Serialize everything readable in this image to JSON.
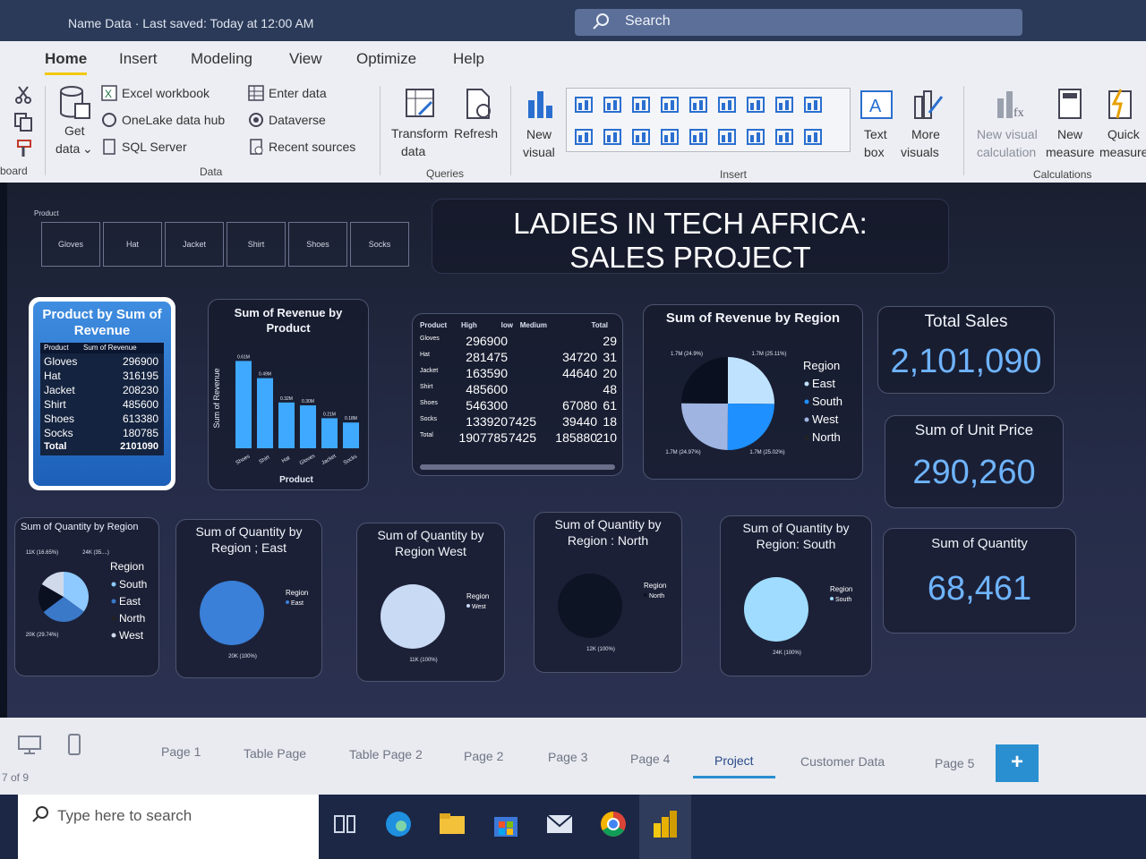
{
  "titlebar": {
    "title": "Name Data · Last saved: Today at 12:00 AM",
    "search": "Search"
  },
  "ribbon": {
    "tabs": [
      "Home",
      "Insert",
      "Modeling",
      "View",
      "Optimize",
      "Help"
    ],
    "clipboard_group": "board",
    "get_data": [
      "Get",
      "data"
    ],
    "data_items": [
      "Excel workbook",
      "OneLake data hub",
      "SQL Server",
      "Enter data",
      "Dataverse",
      "Recent sources"
    ],
    "data_group": "Data",
    "transform": [
      "Transform",
      "data"
    ],
    "refresh": "Refresh",
    "queries_group": "Queries",
    "new_visual": [
      "New",
      "visual"
    ],
    "insert_group": "Insert",
    "text_box": [
      "Text",
      "box"
    ],
    "more_visuals": [
      "More",
      "visuals"
    ],
    "new_visual_calc": [
      "New visual",
      "calculation"
    ],
    "new_measure": [
      "New",
      "measure"
    ],
    "quick_measure": [
      "Quick",
      "measure"
    ],
    "calculations_group": "Calculations"
  },
  "report": {
    "title_line1": "LADIES IN TECH AFRICA:",
    "title_line2": "SALES PROJECT",
    "slicer": {
      "label": "Product",
      "items": [
        "Gloves",
        "Hat",
        "Jacket",
        "Shirt",
        "Shoes",
        "Socks"
      ]
    },
    "product_table": {
      "title": "Product by Sum of Revenue",
      "headers": [
        "Product",
        "Sum of Revenue"
      ],
      "rows": [
        [
          "Gloves",
          "296900"
        ],
        [
          "Hat",
          "316195"
        ],
        [
          "Jacket",
          "208230"
        ],
        [
          "Shirt",
          "485600"
        ],
        [
          "Shoes",
          "613380"
        ],
        [
          "Socks",
          "180785"
        ]
      ],
      "total": [
        "Total",
        "2101090"
      ]
    },
    "matrix": {
      "headers": [
        "Product",
        "High",
        "low",
        "Medium",
        "Total"
      ],
      "rows": [
        [
          "Gloves",
          "296900",
          "",
          "",
          "29"
        ],
        [
          "Hat",
          "281475",
          "",
          "34720",
          "31"
        ],
        [
          "Jacket",
          "163590",
          "",
          "44640",
          "20"
        ],
        [
          "Shirt",
          "485600",
          "",
          "",
          "48"
        ],
        [
          "Shoes",
          "546300",
          "",
          "67080",
          "61"
        ],
        [
          "Socks",
          "133920",
          "7425",
          "39440",
          "18"
        ],
        [
          "Total",
          "1907785",
          "7425",
          "185880",
          "210"
        ]
      ]
    },
    "kpis": {
      "total_sales_label": "Total Sales",
      "total_sales_value": "2,101,090",
      "unit_price_label": "Sum of Unit Price",
      "unit_price_value": "290,260",
      "quantity_label": "Sum of Quantity",
      "quantity_value": "68,461"
    },
    "region_legend": {
      "title": "Region",
      "items": [
        "East",
        "South",
        "West",
        "North"
      ]
    },
    "region_pie_labels": [
      "1.7M (24.9%)",
      "1.7M (25.11%)",
      "1.7M (24.97%)",
      "1.7M (25.02%)"
    ],
    "qty_region_legend": [
      "South",
      "East",
      "North",
      "West"
    ],
    "qty_region_labels": [
      "11K (16.65%)",
      "24K (35....)",
      "20K (29.74%)"
    ],
    "small_pies": [
      {
        "title": "Sum of Quantity by Region ; East",
        "legend": "East",
        "label": "20K (100%)"
      },
      {
        "title": "Sum of Quantity by Region West",
        "legend": "West",
        "label": "11K (100%)"
      },
      {
        "title": "Sum of Quantity by Region : North",
        "legend": "North",
        "label": "12K (100%)"
      },
      {
        "title": "Sum of Quantity by Region: South",
        "legend": "South",
        "label": "24K (100%)"
      }
    ]
  },
  "chart_data": [
    {
      "type": "bar",
      "title": "Sum of Revenue by Product",
      "xlabel": "Product",
      "ylabel": "Sum of Revenue",
      "categories": [
        "Shoes",
        "Shirt",
        "Hat",
        "Gloves",
        "Jacket",
        "Socks"
      ],
      "values": [
        0.61,
        0.49,
        0.32,
        0.3,
        0.21,
        0.18
      ],
      "value_labels": [
        "0.61M",
        "0.49M",
        "0.32M",
        "0.30M",
        "0.21M",
        "0.18M"
      ]
    },
    {
      "type": "pie",
      "title": "Sum of Revenue by Region",
      "categories": [
        "East",
        "South",
        "West",
        "North"
      ],
      "values": [
        25.11,
        25.02,
        24.97,
        24.9
      ],
      "colors": [
        "#bfe3ff",
        "#1e90ff",
        "#9fb4e0",
        "#0b1020"
      ]
    },
    {
      "type": "pie",
      "title": "Sum of Quantity by Region",
      "categories": [
        "South",
        "East",
        "North",
        "West"
      ],
      "values": [
        35.0,
        29.74,
        18.6,
        16.65
      ],
      "colors": [
        "#8ec9ff",
        "#3a78c8",
        "#0b1020",
        "#cfd9ea"
      ]
    }
  ],
  "pages": [
    "Page 1",
    "Table Page",
    "Table Page 2",
    "Page 2",
    "Page 3",
    "Page 4",
    "Project",
    "Customer Data",
    "Page 5"
  ],
  "page_count": "7 of 9",
  "add_page": "+",
  "taskbar": {
    "search_placeholder": "Type here to search"
  },
  "colors": {
    "accent": "#2a8fd0",
    "kpi": "#6fb4ff",
    "bar": "#3fa9ff"
  }
}
